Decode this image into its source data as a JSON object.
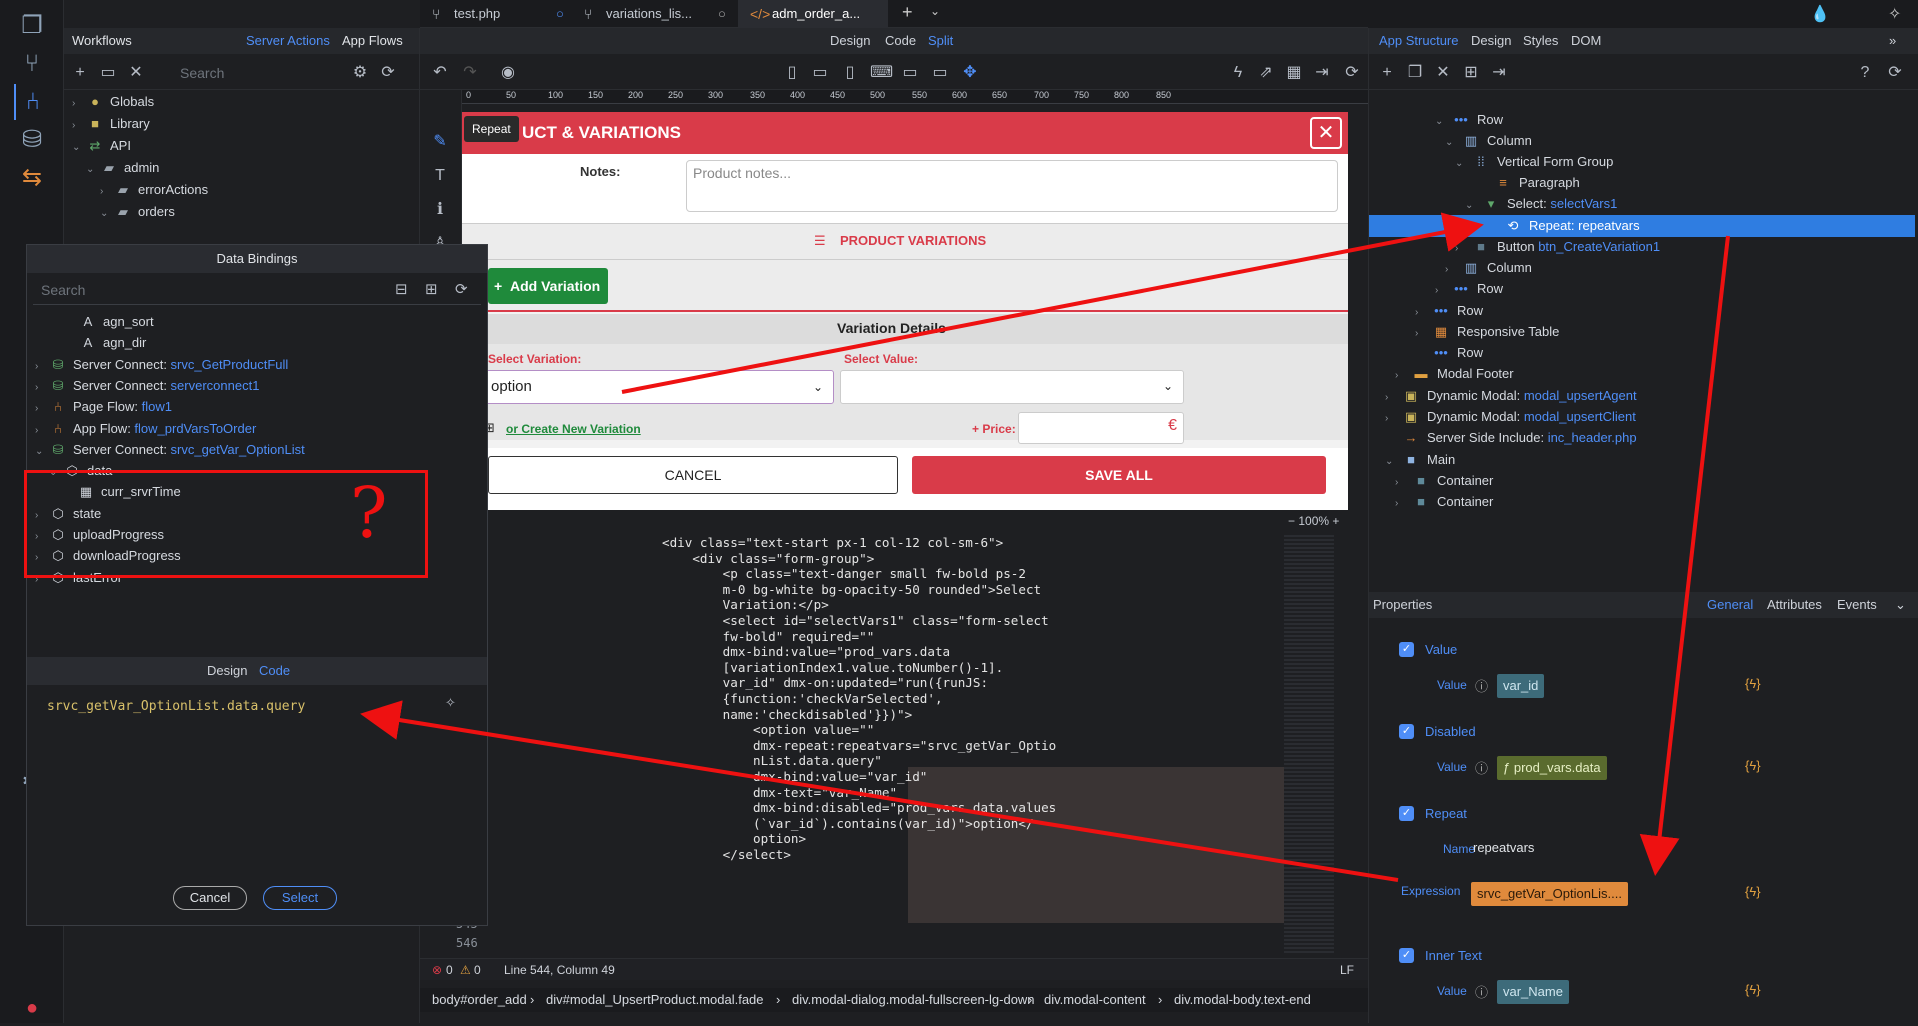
{
  "tabs": [
    {
      "icon": "git-branch-icon",
      "label": "test.php"
    },
    {
      "icon": "git-branch-icon",
      "label": "variations_lis..."
    },
    {
      "icon": "code-icon",
      "label": "adm_order_a..."
    }
  ],
  "workflows": {
    "title": "Workflows",
    "links": [
      "Server Actions",
      "App Flows"
    ],
    "search_placeholder": "Search",
    "tree": [
      {
        "label": "Globals"
      },
      {
        "label": "Library"
      },
      {
        "label": "API"
      },
      {
        "label": "admin"
      },
      {
        "label": "errorActions"
      },
      {
        "label": "orders"
      }
    ]
  },
  "bindings": {
    "title": "Data Bindings",
    "search_placeholder": "Search",
    "items": [
      {
        "prefix": "",
        "label": "agn_sort"
      },
      {
        "prefix": "",
        "label": "agn_dir"
      },
      {
        "prefix": "Server Connect: ",
        "label": "srvc_GetProductFull"
      },
      {
        "prefix": "Server Connect: ",
        "label": "serverconnect1"
      },
      {
        "prefix": "Page Flow: ",
        "label": "flow1"
      },
      {
        "prefix": "App Flow: ",
        "label": "flow_prdVarsToOrder"
      },
      {
        "prefix": "Server Connect: ",
        "label": "srvc_getVar_OptionList"
      },
      {
        "prefix": "",
        "label": "data"
      },
      {
        "prefix": "",
        "label": "curr_srvrTime"
      },
      {
        "prefix": "",
        "label": "state"
      },
      {
        "prefix": "",
        "label": "uploadProgress"
      },
      {
        "prefix": "",
        "label": "downloadProgress"
      },
      {
        "prefix": "",
        "label": "lastError"
      }
    ],
    "tabs": [
      "Design",
      "Code"
    ],
    "expression": "srvc_getVar_OptionList.data.query",
    "cancel": "Cancel",
    "select": "Select",
    "annotation": "?"
  },
  "canvas": {
    "view_tabs": [
      "Design",
      "Code",
      "Split"
    ],
    "ruler": [
      "0",
      "50",
      "100",
      "150",
      "200",
      "250",
      "300",
      "350",
      "400",
      "450",
      "500",
      "550",
      "600",
      "650",
      "700",
      "750",
      "800",
      "850"
    ],
    "repeat_badge": "Repeat",
    "modal_title": "UCT & VARIATIONS",
    "notes_label": "Notes:",
    "notes_placeholder": "Product notes...",
    "variations_title": "PRODUCT VARIATIONS",
    "add_variation": "Add Variation",
    "variation_details": "Variation Details",
    "select_variation_label": "Select Variation:",
    "select_variation_value": "option",
    "select_value_label": "Select Value:",
    "create_variation": "or Create New Variation",
    "price_label": "+ Price:",
    "currency": "€",
    "cancel": "CANCEL",
    "save_all": "SAVE ALL",
    "zoom": "100%"
  },
  "code": {
    "lines": [
      "<div class=\"text-start px-1 col-12 col-sm-6\">",
      "    <div class=\"form-group\">",
      "        <p class=\"text-danger small fw-bold ps-2",
      "        m-0 bg-white bg-opacity-50 rounded\">Select",
      "        Variation:</p>",
      "        <select id=\"selectVars1\" class=\"form-select",
      "        fw-bold\" required=\"\"",
      "        dmx-bind:value=\"prod_vars.data",
      "        [variationIndex1.value.toNumber()-1].",
      "        var_id\" dmx-on:updated=\"run({runJS:",
      "        {function:'checkVarSelected',",
      "        name:'checkdisabled'}})\">",
      "            <option value=\"\"",
      "            dmx-repeat:repeatvars=\"srvc_getVar_Optio",
      "            nList.data.query\"",
      "            dmx-bind:value=\"var_id\"",
      "            dmx-text=\"var_Name\"",
      "            dmx-bind:disabled=\"prod_vars.data.values",
      "            (`var_id`).contains(var_id)\">option</",
      "            option>",
      "        </select>"
    ],
    "line_numbers": [
      "545",
      "546"
    ]
  },
  "status": {
    "errors": "0",
    "warnings": "0",
    "position": "Line 544, Column 49",
    "eol": "LF"
  },
  "breadcrumbs": [
    "body#order_add",
    "div#modal_UpsertProduct.modal.fade",
    "div.modal-dialog.modal-fullscreen-lg-down",
    "div.modal-content",
    "div.modal-body.text-end"
  ],
  "structure": {
    "tabs": [
      "App Structure",
      "Design",
      "Styles",
      "DOM"
    ],
    "tree": [
      {
        "prefix": "",
        "label": "Row"
      },
      {
        "prefix": "",
        "label": "Column"
      },
      {
        "prefix": "",
        "label": "Vertical Form Group"
      },
      {
        "prefix": "",
        "label": "Paragraph"
      },
      {
        "prefix": "Select: ",
        "label": "selectVars1"
      },
      {
        "prefix": "Repeat: ",
        "label": "repeatvars"
      },
      {
        "prefix": "Button ",
        "label": "btn_CreateVariation1"
      },
      {
        "prefix": "",
        "label": "Column"
      },
      {
        "prefix": "",
        "label": "Row"
      },
      {
        "prefix": "",
        "label": "Row"
      },
      {
        "prefix": "",
        "label": "Responsive Table"
      },
      {
        "prefix": "",
        "label": "Row"
      },
      {
        "prefix": "",
        "label": "Modal Footer"
      },
      {
        "prefix": "Dynamic Modal: ",
        "label": "modal_upsertAgent"
      },
      {
        "prefix": "Dynamic Modal: ",
        "label": "modal_upsertClient"
      },
      {
        "prefix": "Server Side Include: ",
        "label": "inc_header.php"
      },
      {
        "prefix": "",
        "label": "Main"
      },
      {
        "prefix": "",
        "label": "Container"
      },
      {
        "prefix": "",
        "label": "Container"
      }
    ]
  },
  "properties": {
    "title": "Properties",
    "tabs": [
      "General",
      "Attributes",
      "Events"
    ],
    "groups": [
      {
        "title": "Value",
        "field": "Value",
        "value": "var_id"
      },
      {
        "title": "Disabled",
        "field": "Value",
        "value": "ƒ prod_vars.data"
      },
      {
        "title": "Repeat",
        "field": "Name",
        "value": "repeatvars",
        "field2": "Expression",
        "value2": "srvc_getVar_OptionLis...."
      },
      {
        "title": "Inner Text",
        "field": "Value",
        "value": "var_Name"
      }
    ]
  },
  "colors": {
    "accent": "#4f8ef7",
    "modal_header": "#d93b49",
    "add_button": "#1f8a3b",
    "highlight": "#e08a3c"
  }
}
